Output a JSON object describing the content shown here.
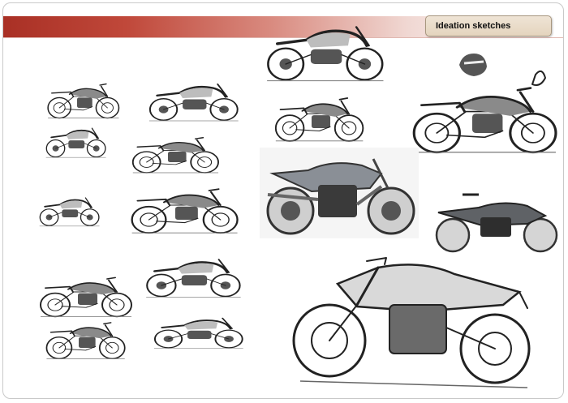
{
  "header": {
    "title": "Ideation sketches",
    "accent_color": "#a93025",
    "badge_color": "#e8dccb"
  }
}
